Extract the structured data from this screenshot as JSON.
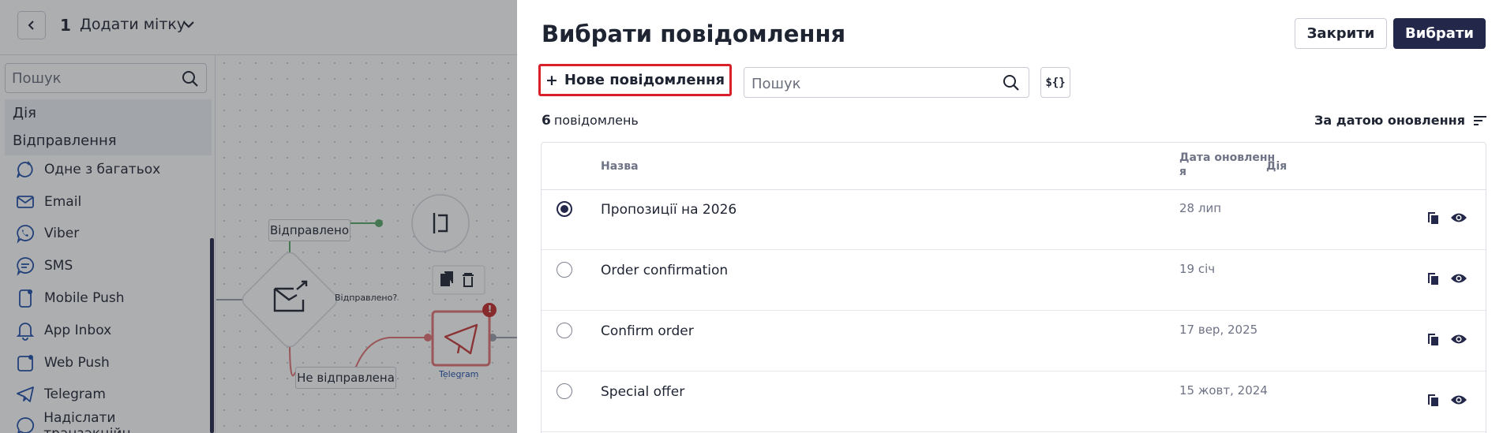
{
  "app": {
    "step_number": "1",
    "step_title": "Додати мітку",
    "sidebar": {
      "search_placeholder": "Пошук",
      "group_action": "Дія",
      "group_sending": "Відправлення",
      "items": [
        {
          "label": "Одне з багатьох",
          "icon": "sparkle-chat-icon"
        },
        {
          "label": "Email",
          "icon": "envelope-icon"
        },
        {
          "label": "Viber",
          "icon": "viber-icon"
        },
        {
          "label": "SMS",
          "icon": "sms-chat-icon"
        },
        {
          "label": "Mobile Push",
          "icon": "mobile-push-icon"
        },
        {
          "label": "App Inbox",
          "icon": "bell-icon"
        },
        {
          "label": "Web Push",
          "icon": "web-push-icon"
        },
        {
          "label": "Telegram",
          "icon": "telegram-icon"
        },
        {
          "label": "Надіслати транзакційн...",
          "icon": "transaction-chat-icon"
        }
      ]
    },
    "canvas": {
      "label_sent": "Відправлено",
      "label_sent_question": "Відправлено?",
      "label_not_sent": "Не відправлена",
      "label_telegram": "Telegram",
      "warning_badge": "!"
    }
  },
  "panel": {
    "title": "Вибрати повідомлення",
    "close_label": "Закрити",
    "select_label": "Вибрати",
    "new_message_label": "Нове повідомлення",
    "search_placeholder": "Пошук",
    "variable_button": "${}",
    "count_number": "6",
    "count_text": "повідомлень",
    "sort_label": "За датою оновлення",
    "table": {
      "headers": {
        "name": "Назва",
        "date_line1": "Дата оновленн",
        "date_line2": "я",
        "action": "Дія"
      },
      "rows": [
        {
          "name": "Пропозиції на 2026",
          "date": "28 лип",
          "selected": true
        },
        {
          "name": "Order confirmation",
          "date": "19 січ",
          "selected": false
        },
        {
          "name": "Confirm order",
          "date": "17 вер, 2025",
          "selected": false
        },
        {
          "name": "Special offer",
          "date": "15 жовт, 2024",
          "selected": false
        }
      ]
    }
  },
  "colors": {
    "brand_dark": "#23284a",
    "highlight_red": "#d9202a",
    "sent_green": "#5aa76a",
    "not_sent_red": "#e07272"
  }
}
